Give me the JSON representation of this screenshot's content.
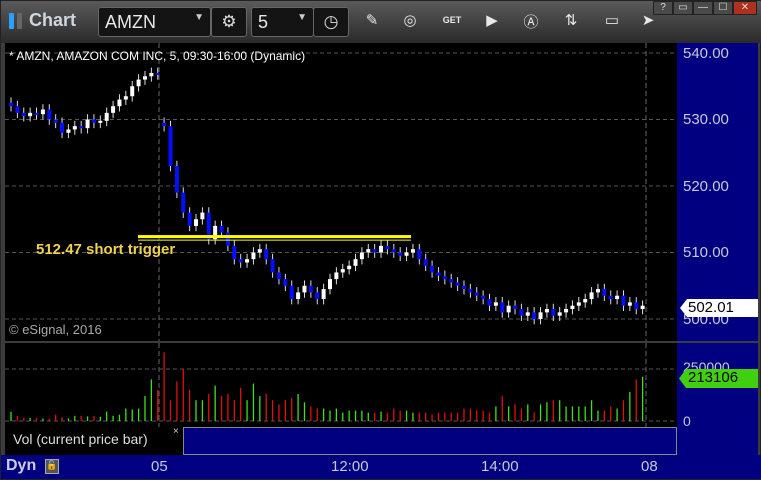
{
  "toolbar": {
    "title": "Chart",
    "symbol": "AMZN",
    "interval": "5",
    "icons": [
      "settings-gear-icon",
      "clock-icon",
      "pencil-icon",
      "study-icon",
      "get-icon",
      "play-icon",
      "alert-icon",
      "link-icon",
      "comment-icon",
      "share-icon"
    ],
    "window_buttons": [
      "?",
      "▭",
      "—",
      "☐",
      "✕"
    ]
  },
  "chart": {
    "header": "* AMZN, AMAZON COM INC, 5, 09:30-16:00 (Dynamic)",
    "copyright": "© eSignal, 2016",
    "annotation": "512.47 short trigger",
    "trigger_price": 512.47,
    "current_price": "502.01",
    "price_ticks": [
      "540.00",
      "530.00",
      "520.00",
      "510.00",
      "500.00"
    ],
    "time_ticks": [
      "05",
      "12:00",
      "14:00",
      "08"
    ]
  },
  "volume": {
    "legend": "Vol (current price bar)",
    "close_label": "×",
    "ticks": [
      "250000",
      "0"
    ],
    "current": "213106"
  },
  "footer": {
    "mode": "Dyn"
  },
  "colors": {
    "up": "#ffffff",
    "down": "#0010ff",
    "vol_up": "#40e020",
    "vol_down": "#e01010",
    "trigger": "#ffff00",
    "axis": "#000080"
  },
  "chart_data": {
    "type": "candlestick",
    "ylim": [
      498,
      541
    ],
    "gap_open": {
      "index": 24,
      "open": 529.5
    },
    "closes": [
      532,
      531,
      530.5,
      531,
      530.8,
      531.5,
      530,
      529.5,
      528,
      528.5,
      529,
      528.7,
      530,
      529.5,
      529.8,
      531,
      532,
      533,
      533.5,
      535,
      536,
      536.5,
      537,
      536.8,
      529,
      523,
      519,
      516,
      514,
      515,
      516,
      512,
      514,
      513,
      511,
      509,
      508.5,
      509,
      510,
      510.5,
      509,
      507,
      506,
      505,
      503,
      504,
      505,
      504,
      503,
      504.5,
      506,
      507,
      507.5,
      508,
      509,
      510,
      510.5,
      510,
      511,
      510.5,
      510,
      509.5,
      510,
      510.5,
      509,
      508,
      507,
      506.5,
      506,
      505.5,
      505,
      504.5,
      504,
      503.5,
      503,
      502,
      502.5,
      501,
      502,
      501.5,
      500.5,
      501,
      500,
      501,
      501.5,
      500.5,
      501,
      501.5,
      502,
      502.5,
      503,
      504,
      504.5,
      503.5,
      503,
      503.5,
      502,
      502.5,
      501.5,
      502
    ],
    "volumes_k": [
      45,
      25,
      15,
      15,
      15,
      12,
      12,
      30,
      18,
      12,
      25,
      25,
      22,
      25,
      20,
      45,
      25,
      30,
      60,
      55,
      60,
      120,
      200,
      150,
      330,
      100,
      190,
      250,
      150,
      100,
      100,
      130,
      170,
      120,
      130,
      100,
      160,
      100,
      180,
      120,
      130,
      100,
      80,
      100,
      110,
      130,
      90,
      70,
      60,
      60,
      50,
      60,
      40,
      50,
      50,
      50,
      40,
      40,
      45,
      40,
      60,
      50,
      50,
      40,
      40,
      40,
      30,
      40,
      40,
      40,
      40,
      60,
      60,
      50,
      50,
      40,
      70,
      120,
      70,
      80,
      60,
      80,
      40,
      80,
      90,
      100,
      100,
      70,
      70,
      70,
      70,
      100,
      50,
      50,
      70,
      60,
      100,
      140,
      200,
      213
    ],
    "vol_ylim": [
      0,
      250000
    ]
  }
}
